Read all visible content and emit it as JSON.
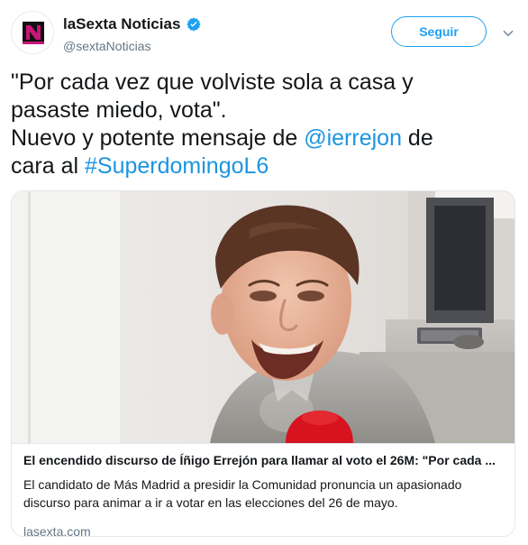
{
  "account": {
    "display_name": "laSexta Noticias",
    "handle": "@sextaNoticias",
    "verified": true,
    "avatar_icon": "lasexta-logo-icon"
  },
  "actions": {
    "follow_label": "Seguir",
    "more_icon": "chevron-down-icon"
  },
  "tweet": {
    "line1": "\"Por cada vez que volviste sola a casa y",
    "line2": "pasaste miedo, vota\".",
    "line3_prefix": "Nuevo y potente mensaje de ",
    "mention": "@ierrejon",
    "line3_suffix": "  de",
    "line4_prefix": "cara al ",
    "hashtag": "#SuperdomingoL6"
  },
  "card": {
    "title": "El encendido discurso de Íñigo Errejón para llamar al voto el 26M: \"Por cada ...",
    "description": "El candidato de Más Madrid a presidir la Comunidad pronuncia un apasionado discurso para animar a ir a votar en las elecciones del 26 de mayo.",
    "domain": "lasexta.com"
  },
  "colors": {
    "accent": "#1da1f2",
    "link": "#1b95e0",
    "text": "#14171a",
    "secondary": "#657786",
    "border": "#e1e8ed"
  }
}
